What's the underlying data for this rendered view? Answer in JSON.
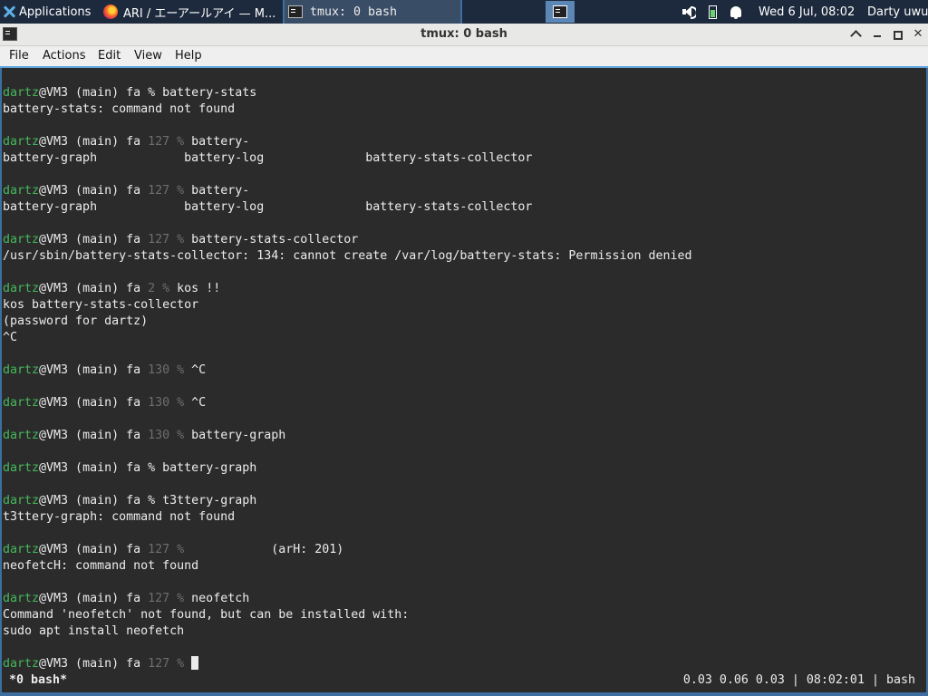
{
  "panel": {
    "applications_label": "Applications",
    "taskbar": [
      {
        "label": "ARI / エーアールアイ — M..."
      },
      {
        "label": "tmux: 0 bash"
      }
    ],
    "clock": "Wed  6 Jul, 08:02",
    "user": "Darty uwu"
  },
  "window": {
    "title": "tmux: 0 bash"
  },
  "menu": {
    "file": "File",
    "actions": "Actions",
    "edit": "Edit",
    "view": "View",
    "help": "Help"
  },
  "terminal": {
    "user": "dartz",
    "host": "@VM3 (main) fa",
    "lines": {
      "l1_cmd": "battery-stats",
      "l2": "battery-stats: command not found",
      "l3_code": "127 %",
      "l3_cmd": "battery-",
      "l4": "battery-graph            battery-log              battery-stats-collector",
      "l5_code": "127 %",
      "l5_cmd": "battery-",
      "l6": "battery-graph            battery-log              battery-stats-collector",
      "l7_code": "127 %",
      "l7_cmd": "battery-stats-collector",
      "l8": "/usr/sbin/battery-stats-collector: 134: cannot create /var/log/battery-stats: Permission denied",
      "l9_code": "2 %",
      "l9_cmd": "kos !!",
      "l10": "kos battery-stats-collector",
      "l11": "(password for dartz)",
      "l12": "^C",
      "l13_code": "130 %",
      "l13_cmd": "^C",
      "l14_code": "130 %",
      "l14_cmd": "^C",
      "l15_code": "130 %",
      "l15_cmd": "battery-graph",
      "l16_cmd": "battery-graph",
      "l17_cmd": "t3ttery-graph",
      "l18": "t3ttery-graph: command not found",
      "l19_code": "127 %",
      "l19_cmd": "           (arH: 201)",
      "l20": "neofetcH: command not found",
      "l21_code": "127 %",
      "l21_cmd": "neofetch",
      "l22": "Command 'neofetch' not found, but can be installed with:",
      "l23": "sudo apt install neofetch",
      "l24_code": "127 %"
    },
    "plain_prompt_symbol": "%"
  },
  "status": {
    "window": "*0 bash*",
    "right": "0.03 0.06 0.03 | 08:02:01 | bash"
  }
}
